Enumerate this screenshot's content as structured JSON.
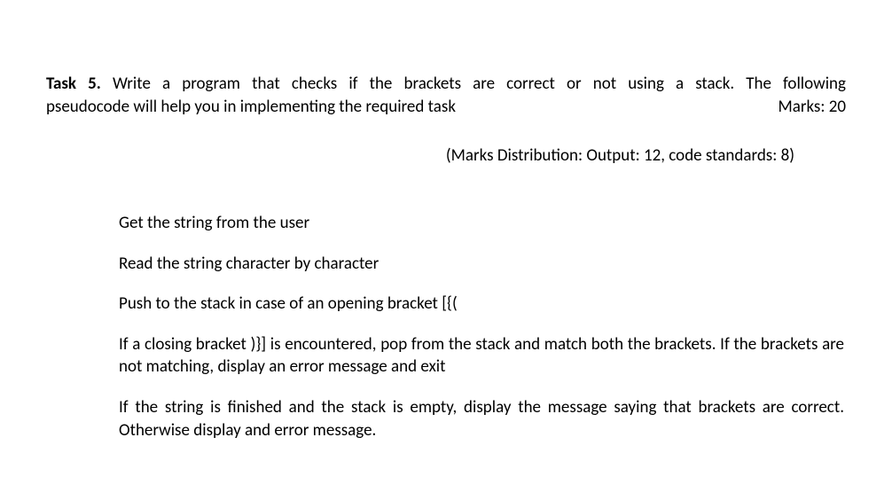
{
  "task": {
    "label": "Task 5.",
    "description_line1": " Write a program that checks if the brackets are correct or not using a stack. The following",
    "description_line2": "pseudocode will help you in implementing the required task",
    "marks_label": "Marks: 20"
  },
  "marks_distribution": "(Marks Distribution: Output: 12, code standards: 8)",
  "pseudocode": {
    "step1": "Get the string from the user",
    "step2": "Read the string character by character",
    "step3": "Push to the stack in case of an opening bracket [{(",
    "step4": "If a closing bracket )}] is encountered, pop from the stack and match both the brackets. If the brackets are not matching, display an error message and exit",
    "step5": "If the string is finished and the stack is empty, display the message saying that brackets are correct. Otherwise display and error message."
  }
}
